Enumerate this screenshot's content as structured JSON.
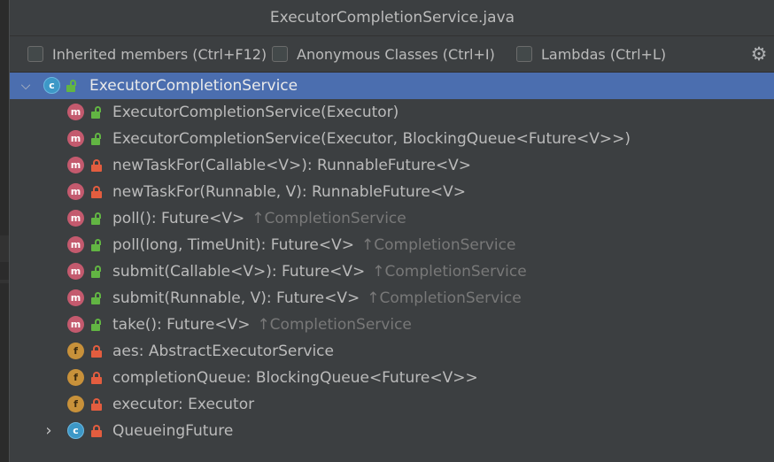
{
  "window": {
    "title": "ExecutorCompletionService.java"
  },
  "filters": [
    {
      "label": "Inherited members (Ctrl+F12)",
      "checked": false
    },
    {
      "label": "Anonymous Classes (Ctrl+I)",
      "checked": false
    },
    {
      "label": "Lambdas (Ctrl+L)",
      "checked": false
    }
  ],
  "settings_icon": "gear-icon",
  "tree": {
    "root": {
      "label": "ExecutorCompletionService",
      "kind": "class",
      "visibility": "public",
      "expanded": true,
      "selected": true
    },
    "members": [
      {
        "label": "ExecutorCompletionService(Executor)",
        "kind": "method",
        "visibility": "public",
        "inherited": ""
      },
      {
        "label": "ExecutorCompletionService(Executor, BlockingQueue<Future<V>>)",
        "kind": "method",
        "visibility": "public",
        "inherited": ""
      },
      {
        "label": "newTaskFor(Callable<V>): RunnableFuture<V>",
        "kind": "method",
        "visibility": "private",
        "inherited": ""
      },
      {
        "label": "newTaskFor(Runnable, V): RunnableFuture<V>",
        "kind": "method",
        "visibility": "private",
        "inherited": ""
      },
      {
        "label": "poll(): Future<V>",
        "kind": "method",
        "visibility": "public",
        "inherited": "↑CompletionService"
      },
      {
        "label": "poll(long, TimeUnit): Future<V>",
        "kind": "method",
        "visibility": "public",
        "inherited": "↑CompletionService"
      },
      {
        "label": "submit(Callable<V>): Future<V>",
        "kind": "method",
        "visibility": "public",
        "inherited": "↑CompletionService"
      },
      {
        "label": "submit(Runnable, V): Future<V>",
        "kind": "method",
        "visibility": "public",
        "inherited": "↑CompletionService"
      },
      {
        "label": "take(): Future<V>",
        "kind": "method",
        "visibility": "public",
        "inherited": "↑CompletionService"
      },
      {
        "label": "aes: AbstractExecutorService",
        "kind": "field",
        "visibility": "private",
        "inherited": ""
      },
      {
        "label": "completionQueue: BlockingQueue<Future<V>>",
        "kind": "field",
        "visibility": "private",
        "inherited": ""
      },
      {
        "label": "executor: Executor",
        "kind": "field",
        "visibility": "private",
        "inherited": ""
      },
      {
        "label": "QueueingFuture",
        "kind": "class",
        "visibility": "private",
        "inherited": "",
        "collapsed": true
      }
    ]
  },
  "kind_letters": {
    "method": "m",
    "class": "c",
    "field": "f"
  },
  "colors": {
    "selection": "#4b6eaf",
    "method_badge": "#c45a6e",
    "class_badge": "#3d98c7",
    "field_badge": "#c8913a",
    "public_lock": "#62b543",
    "private_lock": "#e35d3f",
    "inherited_text": "#787878"
  }
}
